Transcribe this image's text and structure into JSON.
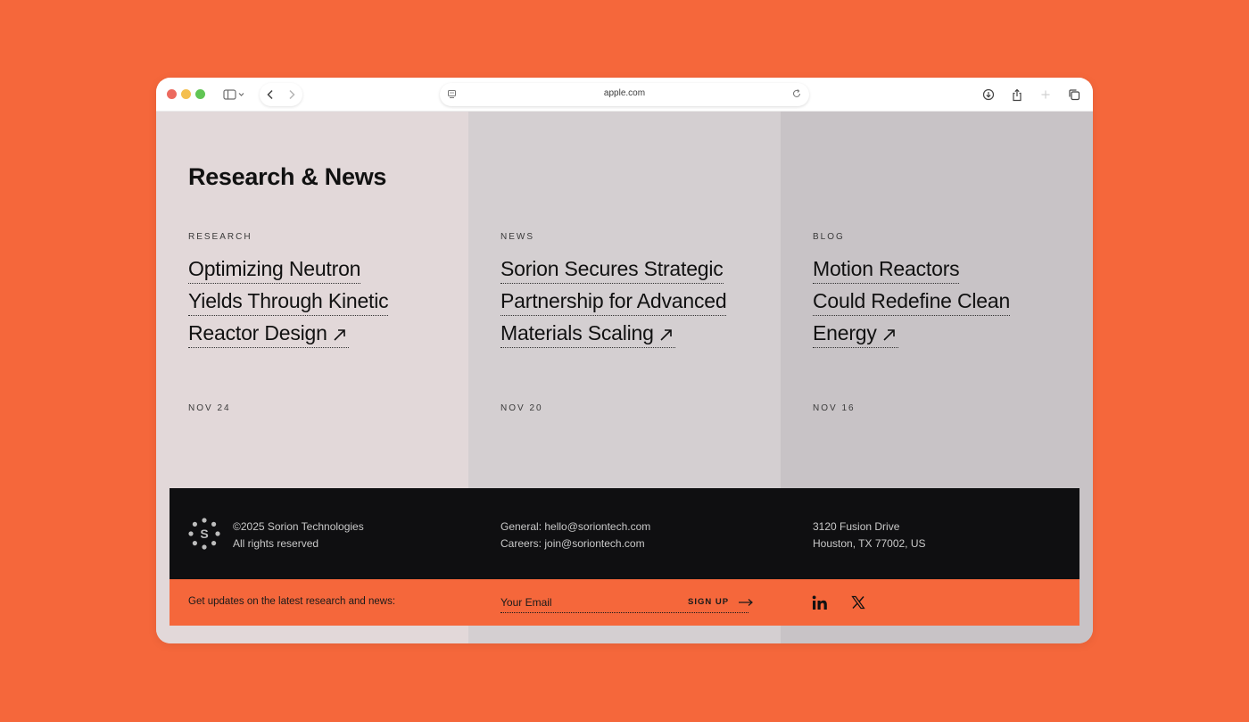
{
  "browser": {
    "url": "apple.com",
    "icons": {
      "sidebar": "sidebar-icon",
      "back": "chevron-left-icon",
      "forward": "chevron-right-icon",
      "reload": "reload-icon",
      "download": "download-icon",
      "share": "share-icon",
      "new_tab": "plus-icon",
      "tabs": "tabs-overview-icon"
    }
  },
  "section": {
    "title": "Research & News"
  },
  "articles": [
    {
      "category": "RESEARCH",
      "lines": [
        "Optimizing Neutron",
        "Yields Through Kinetic",
        "Reactor Design"
      ],
      "date": "NOV 24"
    },
    {
      "category": "NEWS",
      "lines": [
        "Sorion Secures Strategic",
        "Partnership for Advanced",
        "Materials Scaling"
      ],
      "date": "NOV 20"
    },
    {
      "category": "BLOG",
      "lines": [
        "Motion Reactors",
        "Could Redefine Clean",
        "Energy"
      ],
      "date": "NOV 16"
    }
  ],
  "footer": {
    "logo_letter": "S",
    "copyright": "©2025 Sorion Technologies",
    "rights": "All rights reserved",
    "general": "General: hello@soriontech.com",
    "careers": "Careers: join@soriontech.com",
    "street": "3120 Fusion Drive",
    "city": "Houston, TX 77002, US"
  },
  "newsletter": {
    "label": "Get updates on the latest research and news:",
    "placeholder": "Your Email",
    "button": "SIGN UP"
  },
  "colors": {
    "brand_orange": "#F5673B",
    "footer_dark": "#0F0F11",
    "col1": "#E2D8D9",
    "col2": "#D4CFD1",
    "col3": "#C8C3C6"
  }
}
